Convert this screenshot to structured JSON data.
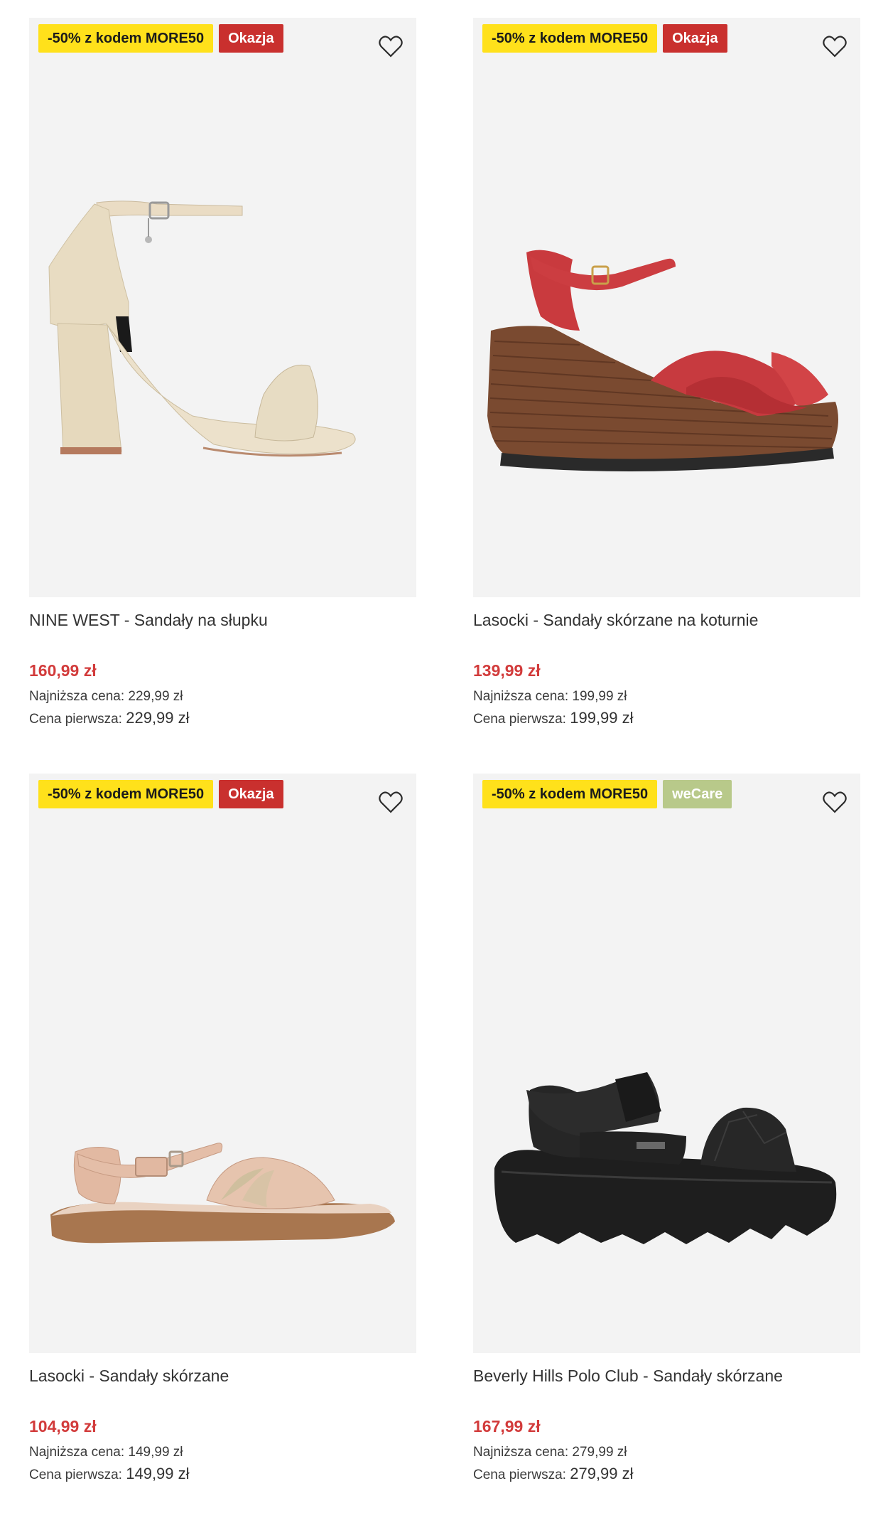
{
  "products": [
    {
      "badges": [
        {
          "label": "-50% z kodem MORE50",
          "kind": "promo"
        },
        {
          "label": "Okazja",
          "kind": "sale"
        }
      ],
      "title": "NINE WEST - Sandały na słupku",
      "price": "160,99 zł",
      "lowest_label": "Najniższa cena:",
      "lowest_value": "229,99 zł",
      "first_label": "Cena pierwsza:",
      "first_value": "229,99 zł",
      "image_icon": "beige-block-heel-sandal"
    },
    {
      "badges": [
        {
          "label": "-50% z kodem MORE50",
          "kind": "promo"
        },
        {
          "label": "Okazja",
          "kind": "sale"
        }
      ],
      "title": "Lasocki - Sandały skórzane na koturnie",
      "price": "139,99 zł",
      "lowest_label": "Najniższa cena:",
      "lowest_value": "199,99 zł",
      "first_label": "Cena pierwsza:",
      "first_value": "199,99 zł",
      "image_icon": "red-wedge-sandal"
    },
    {
      "badges": [
        {
          "label": "-50% z kodem MORE50",
          "kind": "promo"
        },
        {
          "label": "Okazja",
          "kind": "sale"
        }
      ],
      "title": "Lasocki - Sandały skórzane",
      "price": "104,99 zł",
      "lowest_label": "Najniższa cena:",
      "lowest_value": "149,99 zł",
      "first_label": "Cena pierwsza:",
      "first_value": "149,99 zł",
      "image_icon": "nude-flat-sandal"
    },
    {
      "badges": [
        {
          "label": "-50% z kodem MORE50",
          "kind": "promo"
        },
        {
          "label": "weCare",
          "kind": "care"
        }
      ],
      "title": "Beverly Hills Polo Club - Sandały skórzane",
      "price": "167,99 zł",
      "lowest_label": "Najniższa cena:",
      "lowest_value": "279,99 zł",
      "first_label": "Cena pierwsza:",
      "first_value": "279,99 zł",
      "image_icon": "black-chunky-sandal"
    }
  ],
  "colors": {
    "promo_badge": "#ffe11b",
    "sale_badge": "#c9302e",
    "care_badge": "#b8c98a",
    "price": "#d23b3b",
    "image_background": "#f3f3f3"
  },
  "icons": {
    "favorite": "heart-outline-icon"
  }
}
